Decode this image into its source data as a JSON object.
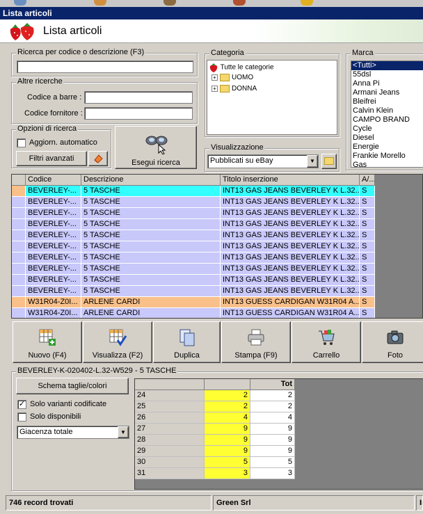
{
  "window": {
    "title": "Lista articoli"
  },
  "header": {
    "title": "Lista articoli"
  },
  "search": {
    "legend": "Ricerca per codice o descrizione (F3)",
    "value": ""
  },
  "other_search": {
    "legend": "Altre ricerche",
    "barcode_label": "Codice a barre :",
    "supplier_label": "Codice fornitore :"
  },
  "options": {
    "legend": "Opzioni di ricerca",
    "auto_update_label": "Aggiorn. automatico",
    "advanced_filters_label": "Filtri avanzati"
  },
  "search_button_label": "Esegui ricerca",
  "category": {
    "legend": "Categoria",
    "root": "Tutte le categorie",
    "children": [
      "UOMO",
      "DONNA"
    ]
  },
  "view": {
    "legend": "Visualizzazione",
    "selected": "Pubblicati su eBay"
  },
  "brand": {
    "legend": "Marca",
    "items": [
      "<Tutti>",
      "55dsl",
      "Anna Pi",
      "Armani Jeans",
      "Bleifrei",
      "Calvin Klein",
      "CAMPO BRAND",
      "Cycle",
      "Diesel",
      "Energie",
      "Frankie Morello",
      "Gas"
    ]
  },
  "grid": {
    "headers": [
      "Codice",
      "Descrizione",
      "Titolo inserzione",
      "A/..."
    ],
    "rows": [
      {
        "code": "BEVERLEY-...",
        "desc": "5 TASCHE",
        "title": "INT13 GAS JEANS BEVERLEY K L.32...",
        "flag": "S",
        "style": "selected"
      },
      {
        "code": "BEVERLEY-...",
        "desc": "5 TASCHE",
        "title": "INT13 GAS JEANS BEVERLEY K L.32...",
        "flag": "S",
        "style": "normal"
      },
      {
        "code": "BEVERLEY-...",
        "desc": "5 TASCHE",
        "title": "INT13 GAS JEANS BEVERLEY K L.32...",
        "flag": "S",
        "style": "normal"
      },
      {
        "code": "BEVERLEY-...",
        "desc": "5 TASCHE",
        "title": "INT13 GAS JEANS BEVERLEY K L.32...",
        "flag": "S",
        "style": "normal"
      },
      {
        "code": "BEVERLEY-...",
        "desc": "5 TASCHE",
        "title": "INT13 GAS JEANS BEVERLEY K L.32...",
        "flag": "S",
        "style": "normal"
      },
      {
        "code": "BEVERLEY-...",
        "desc": "5 TASCHE",
        "title": "INT13 GAS JEANS BEVERLEY K L.32...",
        "flag": "S",
        "style": "normal"
      },
      {
        "code": "BEVERLEY-...",
        "desc": "5 TASCHE",
        "title": "INT13 GAS JEANS BEVERLEY K L.32...",
        "flag": "S",
        "style": "normal"
      },
      {
        "code": "BEVERLEY-...",
        "desc": "5 TASCHE",
        "title": "INT13 GAS JEANS BEVERLEY K L.32...",
        "flag": "S",
        "style": "normal"
      },
      {
        "code": "BEVERLEY-...",
        "desc": "5 TASCHE",
        "title": "INT13 GAS JEANS BEVERLEY K L.32...",
        "flag": "S",
        "style": "normal"
      },
      {
        "code": "BEVERLEY-...",
        "desc": "5 TASCHE",
        "title": "INT13 GAS JEANS BEVERLEY K L.32...",
        "flag": "S",
        "style": "normal"
      },
      {
        "code": "W31R04-Z0I...",
        "desc": "ARLENE CARDI",
        "title": "INT13 GUESS CARDIGAN W31R04 A...",
        "flag": "S",
        "style": "orange"
      },
      {
        "code": "W31R04-Z0I...",
        "desc": "ARLENE CARDI",
        "title": "INT13 GUESS CARDIGAN W31R04 A...",
        "flag": "S",
        "style": "normal"
      }
    ]
  },
  "toolbar": {
    "buttons": [
      {
        "label": "Nuovo (F4)",
        "icon": "new-grid-icon"
      },
      {
        "label": "Visualizza (F2)",
        "icon": "view-grid-icon"
      },
      {
        "label": "Duplica",
        "icon": "duplicate-icon"
      },
      {
        "label": "Stampa (F9)",
        "icon": "printer-icon"
      },
      {
        "label": "Carrello",
        "icon": "cart-icon"
      },
      {
        "label": "Foto",
        "icon": "camera-icon"
      }
    ]
  },
  "detail": {
    "legend": "BEVERLEY-K-020402-L.32-W529 - 5 TASCHE",
    "schema_button": "Schema taglie/colori",
    "only_coded_label": "Solo varianti codificate",
    "only_coded_checked": "✓",
    "only_available_label": "Solo disponibili",
    "stock_select": "Giacenza totale",
    "table_header_tot": "Tot",
    "sizes": [
      {
        "size": "24",
        "qty": "2",
        "tot": "2"
      },
      {
        "size": "25",
        "qty": "2",
        "tot": "2"
      },
      {
        "size": "26",
        "qty": "4",
        "tot": "4"
      },
      {
        "size": "27",
        "qty": "9",
        "tot": "9"
      },
      {
        "size": "28",
        "qty": "9",
        "tot": "9"
      },
      {
        "size": "29",
        "qty": "9",
        "tot": "9"
      },
      {
        "size": "30",
        "qty": "5",
        "tot": "5"
      },
      {
        "size": "31",
        "qty": "3",
        "tot": "3"
      }
    ]
  },
  "status": {
    "records": "746 record trovati",
    "company": "Green Srl",
    "extra": "In"
  },
  "colors": {
    "selected_row": "#33ffff",
    "normal_row": "#c8c8fa",
    "orange_row": "#f9c08a",
    "qty_cell": "#ffff33",
    "title_bar": "#0a246a"
  }
}
